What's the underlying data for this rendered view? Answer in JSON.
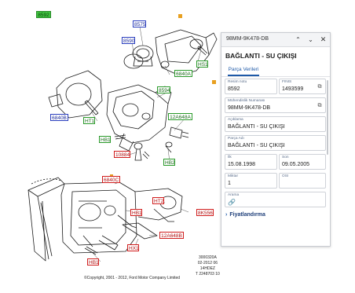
{
  "diagram": {
    "callouts": [
      {
        "id": "8575-callout",
        "label": "8575",
        "style": "blue"
      },
      {
        "id": "8590-callout",
        "label": "8590",
        "style": "blue"
      },
      {
        "id": "hs1-callout",
        "label": "HS1",
        "style": "green"
      },
      {
        "id": "6840a-top-callout",
        "label": "6840A",
        "style": "green"
      },
      {
        "id": "8594-callout",
        "label": "8594",
        "style": "green"
      },
      {
        "id": "6840b-callout",
        "label": "6840B",
        "style": "blue"
      },
      {
        "id": "ht1-callout",
        "label": "HT1",
        "style": "green"
      },
      {
        "id": "12a648a-callout",
        "label": "12A648A",
        "style": "green"
      },
      {
        "id": "hb1-upper-callout",
        "label": "HB1",
        "style": "green"
      },
      {
        "id": "10884-callout",
        "label": "10884",
        "style": "red"
      },
      {
        "id": "hb2-callout",
        "label": "HB2",
        "style": "green"
      },
      {
        "id": "6840c-callout",
        "label": "6840C",
        "style": "red"
      },
      {
        "id": "ht2-callout",
        "label": "HT2",
        "style": "red"
      },
      {
        "id": "hb1-mid-callout",
        "label": "HB1",
        "style": "red"
      },
      {
        "id": "8k556-callout",
        "label": "8K556",
        "style": "red"
      },
      {
        "id": "12a648b-callout",
        "label": "12A648B",
        "style": "red"
      },
      {
        "id": "hx1-callout",
        "label": "HX1",
        "style": "red"
      },
      {
        "id": "hb1-lower-callout",
        "label": "HB1",
        "style": "red"
      }
    ],
    "copyright": "©Copyright, 2001 - 2012, Ford Motor Company Limited",
    "doc_code": [
      "3000320A",
      "02-2012 06",
      "14HDEZ",
      "T 2248703 10"
    ]
  },
  "panel": {
    "part_code": "98MM-9K478-DB",
    "title": "BAĞLANTI - SU ÇIKIŞI",
    "tab_label": "Parça Verileri",
    "fields": {
      "ref_no": {
        "label": "Resim notu",
        "value": "8592"
      },
      "finis": {
        "label": "FINIS",
        "value": "1493599"
      },
      "engineering_no": {
        "label": "Mühendislik Numarası",
        "value": "98MM-9K478-DB"
      },
      "description": {
        "label": "Açıklama",
        "value": "BAĞLANTI - SU ÇIKIŞI"
      },
      "part_name": {
        "label": "Parça Adı",
        "value": "BAĞLANTI - SU ÇIKIŞI"
      },
      "start": {
        "label": "İlk",
        "value": "15.08.1998"
      },
      "end": {
        "label": "Son",
        "value": "09.05.2005"
      },
      "quantity": {
        "label": "Miktar",
        "value": "1"
      },
      "osi": {
        "label": "OSI",
        "value": ""
      },
      "search": {
        "label": "Arama",
        "value": ""
      }
    },
    "pricing_label": "Fiyatlandırma"
  },
  "icons": {
    "prev": "chevron-up-icon",
    "next": "chevron-down-icon",
    "close": "close-icon",
    "copy": "copy-icon",
    "link": "link-icon",
    "expand": "chevron-right-icon"
  },
  "colors": {
    "accent": "#1f5aa8",
    "callout_blue": "#2b3fbf",
    "callout_green": "#2a9a2a",
    "callout_red": "#d01c1c",
    "highlight": "#e8a020"
  }
}
